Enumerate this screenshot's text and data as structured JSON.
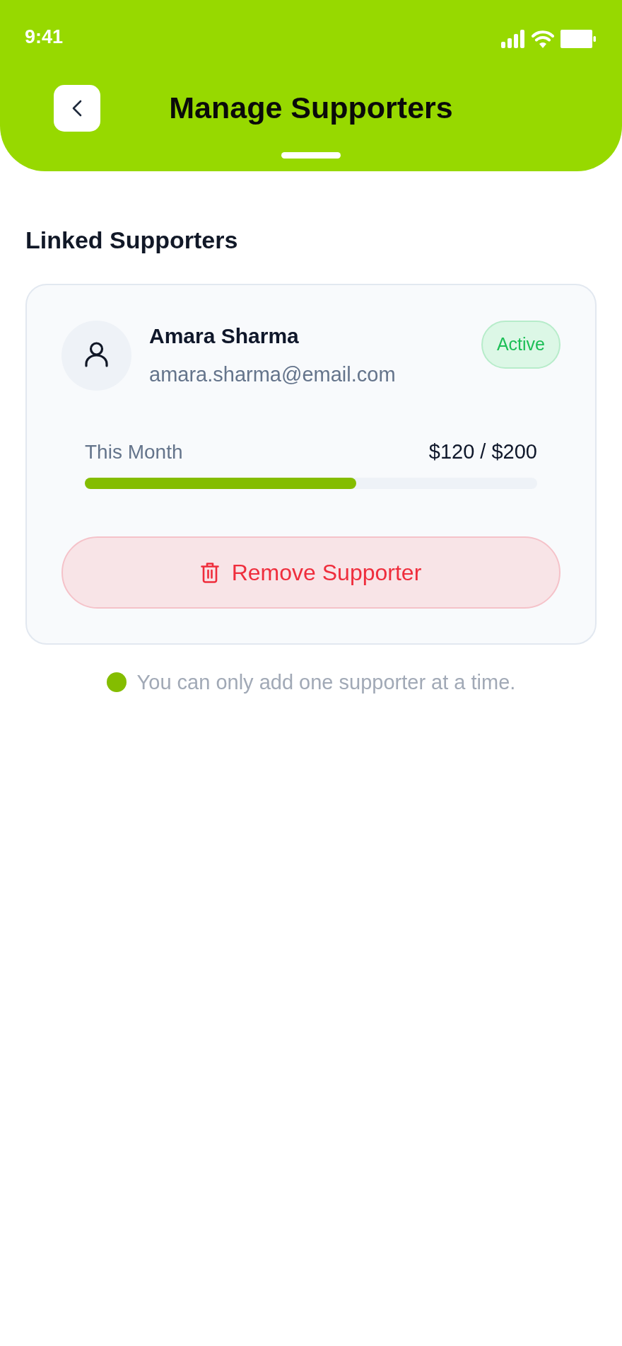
{
  "status_bar": {
    "time": "9:41"
  },
  "header": {
    "title": "Manage Supporters"
  },
  "section_title": "Linked Supporters",
  "supporters": [
    {
      "name": "Amara Sharma",
      "email": "amara.sharma@email.com",
      "status": {
        "kind": "active",
        "label": "Active"
      },
      "usage": {
        "label": "This Month",
        "reading": "$120 / $200",
        "level": 0.6
      },
      "remove_button": "Remove Supporter"
    }
  ],
  "note": "You can only add one supporter at a time."
}
